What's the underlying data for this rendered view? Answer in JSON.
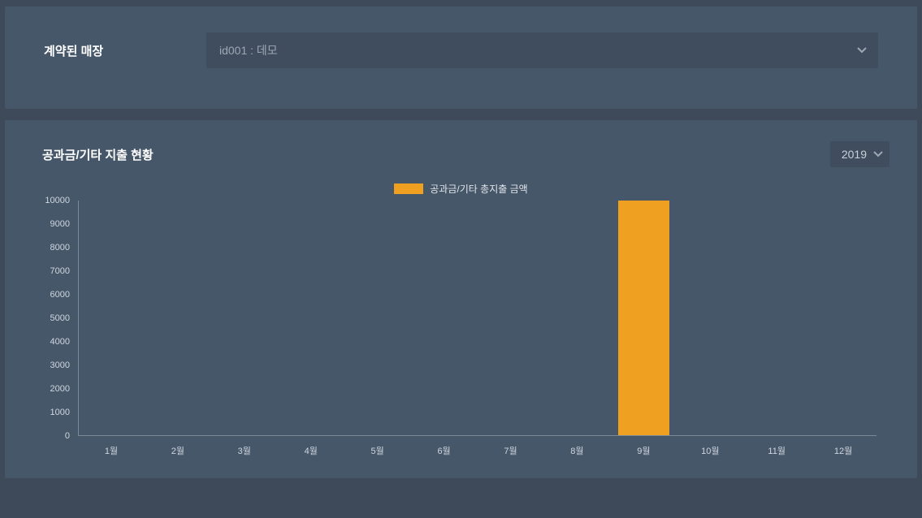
{
  "filter": {
    "label": "계약된 매장",
    "store_select_value": "id001 : 데모"
  },
  "chart": {
    "title": "공과금/기타 지출 현황",
    "year_value": "2019",
    "legend_label": "공과금/기타 총지출 금액"
  },
  "colors": {
    "bar": "#f0a020"
  },
  "chart_data": {
    "type": "bar",
    "title": "공과금/기타 지출 현황",
    "xlabel": "",
    "ylabel": "",
    "categories": [
      "1월",
      "2월",
      "3월",
      "4월",
      "5월",
      "6월",
      "7월",
      "8월",
      "9월",
      "10월",
      "11월",
      "12월"
    ],
    "series": [
      {
        "name": "공과금/기타 총지출 금액",
        "values": [
          0,
          0,
          0,
          0,
          0,
          0,
          0,
          0,
          10000,
          0,
          0,
          0
        ]
      }
    ],
    "ylim": [
      0,
      10000
    ],
    "y_ticks": [
      0,
      1000,
      2000,
      3000,
      4000,
      5000,
      6000,
      7000,
      8000,
      9000,
      10000
    ]
  }
}
